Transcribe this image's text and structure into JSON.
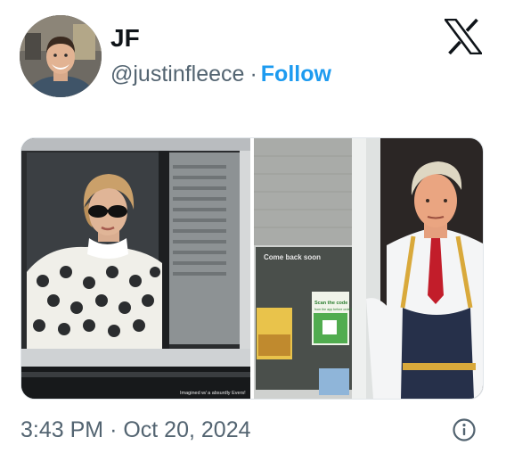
{
  "author": {
    "display_name": "JF",
    "handle": "@justinfleece",
    "separator": "·",
    "follow_label": "Follow"
  },
  "brand_icon": "x-logo-icon",
  "media": {
    "left_image": {
      "subject": "woman-in-car-window"
    },
    "right_image": {
      "subject": "man-at-drive-thru-window",
      "sign": {
        "heading": "Come back soon",
        "scan_text": "Scan the code",
        "scan_subtext": "from the app before ordering"
      }
    },
    "watermark": "Imagined w/ a absurdly Evers!"
  },
  "timestamp": {
    "time": "3:43 PM",
    "separator": "·",
    "date": "Oct 20, 2024"
  },
  "colors": {
    "text_primary": "#0f1419",
    "text_secondary": "#536471",
    "accent": "#1d9bf0",
    "border": "#e1e6ea"
  },
  "icons": {
    "info": "info-icon"
  }
}
